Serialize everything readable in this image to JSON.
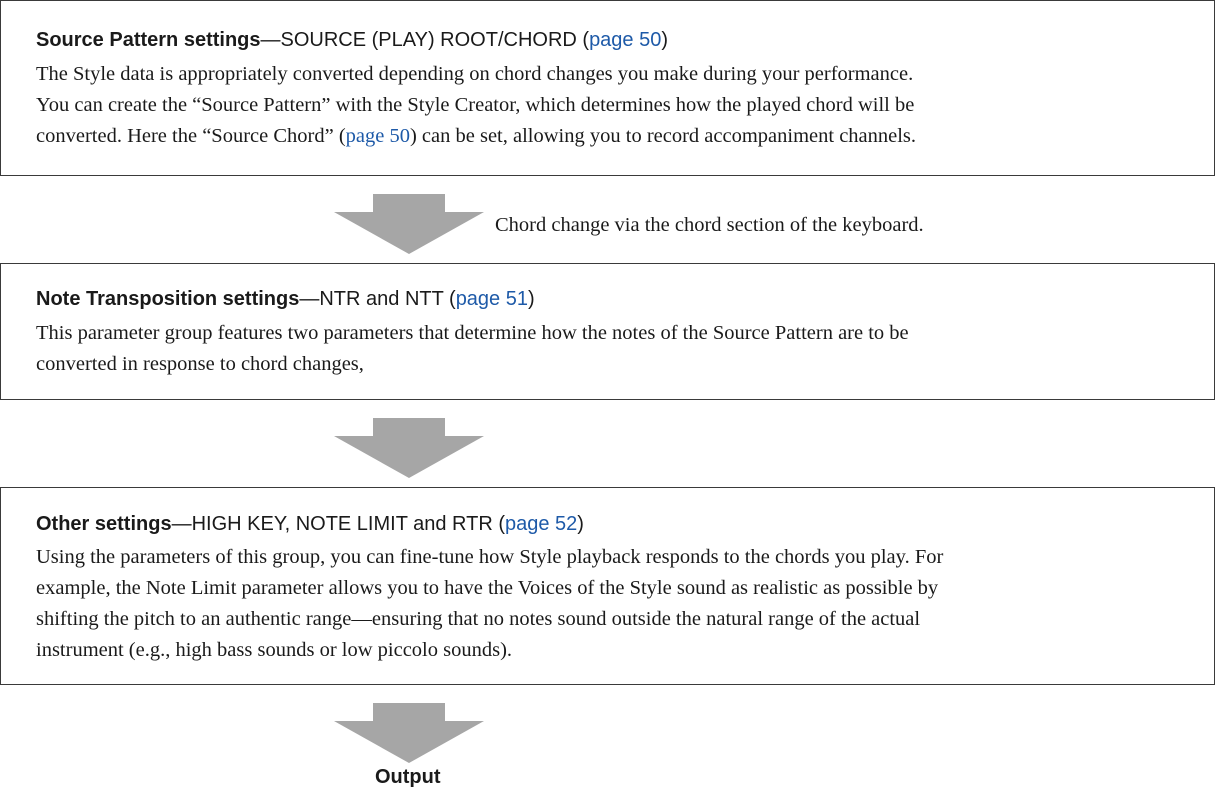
{
  "boxes": [
    {
      "title_bold": "Source Pattern settings",
      "title_rest": "—SOURCE (PLAY) ROOT/CHORD (",
      "title_link": "page 50",
      "title_close": ")",
      "lines": [
        {
          "text": "The Style data is appropriately converted depending on chord changes you make during your performance."
        },
        {
          "text": "You can create the “Source Pattern” with the Style Creator, which determines how the played chord will be"
        },
        {
          "pre": "converted. Here the “Source Chord” (",
          "link": "page 50",
          "post": ") can be set, allowing you to record accompaniment channels."
        }
      ]
    },
    {
      "title_bold": "Note Transposition settings",
      "title_rest": "—NTR and NTT (",
      "title_link": "page 51",
      "title_close": ")",
      "lines": [
        {
          "text": "This parameter group features two parameters that determine how the notes of the Source Pattern are to be"
        },
        {
          "text": "converted in response to chord changes,"
        }
      ]
    },
    {
      "title_bold": "Other settings",
      "title_rest": "—HIGH KEY, NOTE LIMIT and RTR (",
      "title_link": "page 52",
      "title_close": ")",
      "lines": [
        {
          "text": "Using the parameters of this group, you can fine-tune how Style playback responds to the chords you play. For"
        },
        {
          "text": "example, the Note Limit parameter allows you to have the Voices of the Style sound as realistic as possible by"
        },
        {
          "text": "shifting the pitch to an authentic range—ensuring that no notes sound outside the natural range of the actual"
        },
        {
          "text": "instrument (e.g., high bass sounds or low piccolo sounds)."
        }
      ]
    }
  ],
  "arrow_caption": "Chord change via the chord section of the keyboard.",
  "output_label": "Output",
  "colors": {
    "arrow": "#a6a6a6",
    "link": "#1e5aa8",
    "border": "#3a3a3a"
  }
}
